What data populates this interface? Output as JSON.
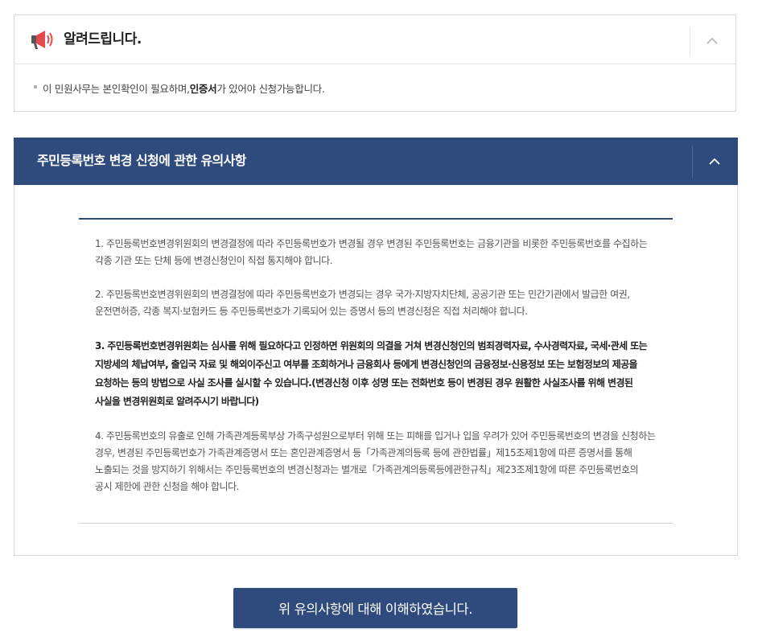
{
  "notice": {
    "title": "알려드립니다.",
    "text_before": "이 민원사무는 본인확인이 필요하며, ",
    "text_bold": "인증서",
    "text_after": "가 있어야 신청가능합니다."
  },
  "section": {
    "title": "주민등록번호 변경 신청에 관한 유의사항",
    "paragraphs": [
      "1. 주민등록번호변경위원회의 변경결정에 따라 주민등록번호가 변경될 경우 변경된 주민등록번호는 금융기관을 비롯한 주민등록번호를 수집하는 각종 기관 또는 단체 등에 변경신청인이 직접 통지해야 합니다.",
      "2. 주민등록번호변경위원회의 변경결정에 따라 주민등록번호가 변경되는 경우 국가·지방자치단체, 공공기관 또는 민간기관에서 발급한 여권, 운전면허증, 각종 복지·보험카드 등 주민등록번호가 기록되어 있는 증명서 등의 변경신청은 직접 처리해야 합니다.",
      "3. 주민등록번호변경위원회는 심사를 위해 필요하다고 인정하면 위원회의 의결을 거쳐 변경신청인의 범죄경력자료, 수사경력자료, 국세·관세 또는 지방세의 체납여부, 출입국 자료 및 해외이주신고 여부를 조회하거나 금융회사 등에게 변경신청인의 금융정보·신용정보 또는 보험정보의 제공을 요청하는 등의 방법으로 사실 조사를 실시할 수 있습니다.(변경신청 이후 성명 또는 전화번호 등이 변경된 경우 원활한 사실조사를 위해 변경된 사실을 변경위원회로 알려주시기 바랍니다)",
      "4. 주민등록번호의 유출로 인해 가족관계등록부상 가족구성원으로부터 위해 또는 피해를 입거나 입을 우려가 있어 주민등록번호의 변경을 신청하는 경우, 변경된 주민등록번호가 가족관계증명서 또는 혼인관계증명서 등「가족관계의등록 등에 관한법률」제15조제1항에 따른 증명서를 통해 노출되는 것을 방지하기 위해서는 주민등록번호의 변경신청과는 별개로「가족관계의등록등에관한규칙」제23조제1항에 따른 주민등록번호의 공시 제한에 관한 신청을 해야 합니다."
    ]
  },
  "confirm_button": {
    "label": "위 유의사항에 대해 이해하였습니다."
  },
  "icons": {
    "notice": "megaphone-icon",
    "collapse": "chevron-up-icon"
  },
  "colors": {
    "primary": "#2f4a7c",
    "megaphone": "#e5484d",
    "border": "#d8d8d8"
  }
}
